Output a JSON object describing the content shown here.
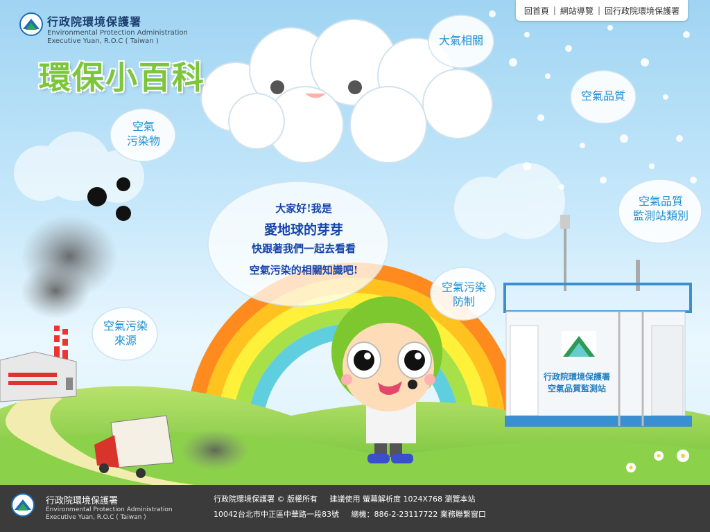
{
  "top_nav": {
    "home": "回首頁",
    "sitemap": "網站導覽",
    "back_epa": "回行政院環境保護署"
  },
  "header": {
    "org_zh": "行政院環境保護署",
    "org_en_1": "Environmental Protection Administration",
    "org_en_2": "Executive Yuan, R.O.C ( Taiwan )",
    "brand_title": "環保小百科"
  },
  "bubbles": {
    "air_related": "大氣相關",
    "air_quality": "空氣品質",
    "pollutant_l1": "空氣",
    "pollutant_l2": "污染物",
    "station_type_l1": "空氣品質",
    "station_type_l2": "監測站類別",
    "prevention_l1": "空氣污染",
    "prevention_l2": "防制",
    "source_l1": "空氣污染",
    "source_l2": "來源"
  },
  "speech": {
    "line1": "大家好!我是",
    "line2": "愛地球的芽芽",
    "line3": "快跟著我們一起去看看",
    "line4": "空氣污染的相關知識吧!"
  },
  "station": {
    "label_l1": "行政院環境保護署",
    "label_l2": "空氣品質監測站"
  },
  "footer": {
    "org_zh": "行政院環境保護署",
    "org_en_1": "Environmental Protection Administration",
    "org_en_2": "Executive Yuan, R.O.C ( Taiwan )",
    "copyright": "行政院環境保護署 © 版權所有",
    "resolution": "建議使用 螢幕解析度 1024X768 瀏覽本站",
    "address": "10042台北市中正區中華路一段83號",
    "phone": "總機：886-2-23117722 業務聯繫窗口"
  },
  "colors": {
    "sky": "#9fd4f2",
    "grass": "#8cd14a",
    "bubble_text": "#1d8fd0",
    "brand_green": "#7bc63a",
    "footer_bg": "#3b3b3b"
  }
}
